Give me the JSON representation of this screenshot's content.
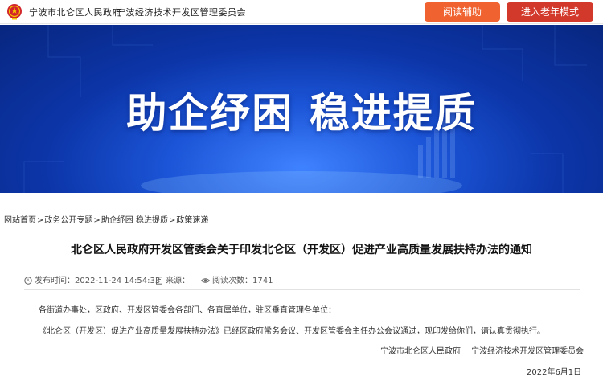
{
  "header": {
    "site_name_primary": "宁波市北仑区人民政府",
    "site_name_secondary": "宁波经济技术开发区管理委员会",
    "reading_assist_label": "阅读辅助",
    "elder_mode_label": "进入老年模式",
    "colors": {
      "reading_assist": "#f0622f",
      "elder_mode": "#d2392b"
    }
  },
  "banner": {
    "title": "助企纾困 稳进提质",
    "colors": {
      "background": "#0c35a8",
      "glow": "#3f82ff"
    }
  },
  "breadcrumb": {
    "items": [
      "网站首页",
      "政务公开专题",
      "助企纾困 稳进提质",
      "政策速递"
    ],
    "separator": ">"
  },
  "article": {
    "title": "北仑区人民政府开发区管委会关于印发北仑区（开发区）促进产业高质量发展扶持办法的通知",
    "meta": {
      "publish_label": "发布时间：",
      "publish_time": "2022-11-24 14:54:33",
      "source_label": "来源：",
      "source": "",
      "views_label": "阅读次数：",
      "views": "1741"
    },
    "greeting": "各街道办事处，区政府、开发区管委会各部门、各直属单位，驻区垂直管理各单位：",
    "body": "《北仑区（开发区）促进产业高质量发展扶持办法》已经区政府常务会议、开发区管委会主任办公会议通过，现印发给你们，请认真贯彻执行。",
    "signature": "宁波市北仑区人民政府　  宁波经济技术开发区管理委员会",
    "date": "2022年6月1日"
  }
}
